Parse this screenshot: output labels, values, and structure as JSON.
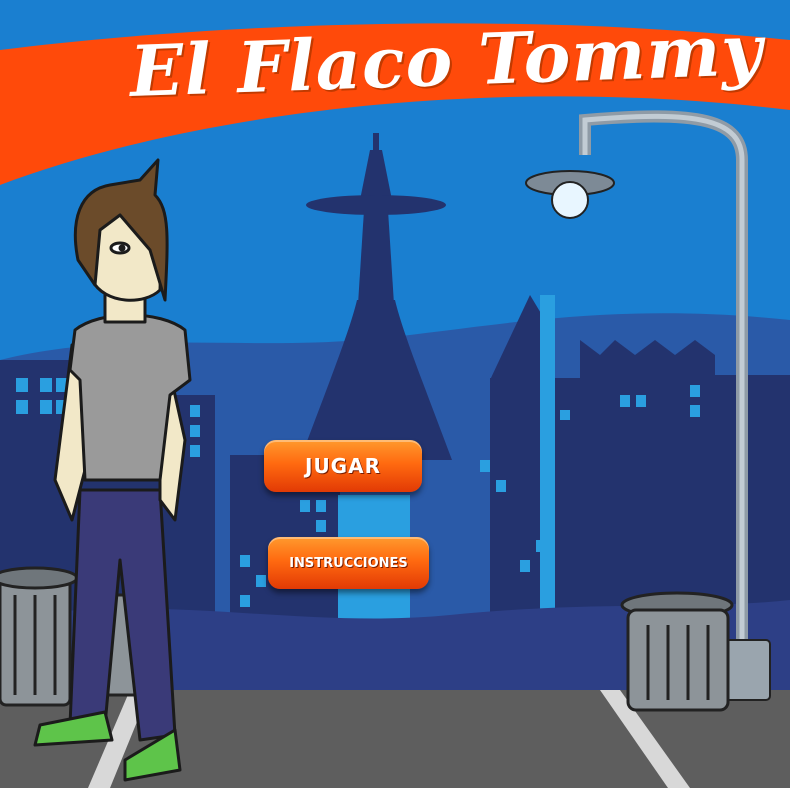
{
  "game": {
    "title": "El Flaco Tommy"
  },
  "menu": {
    "play_label": "JUGAR",
    "instructions_label": "INSTRUCCIONES"
  },
  "colors": {
    "sky": "#1a7fd0",
    "banner": "#ff4a0a",
    "city_dark": "#23336e",
    "window_light": "#2a9fe0",
    "street": "#5e5e5e",
    "button_orange": "#ff6a10"
  }
}
